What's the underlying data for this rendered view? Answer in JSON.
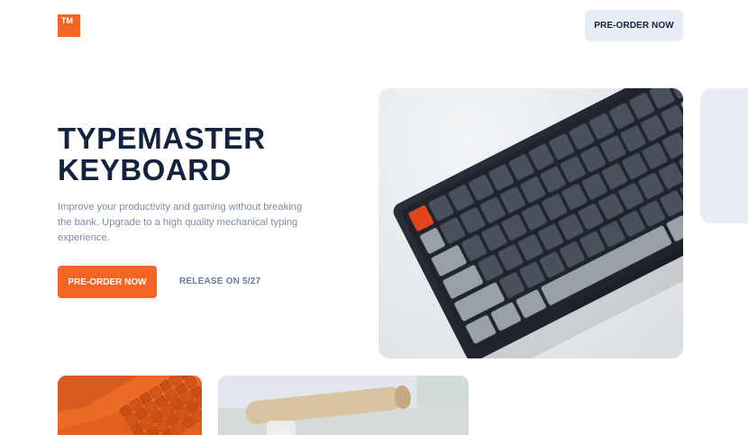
{
  "header": {
    "logo_text": "TM",
    "cta_label": "PRE-ORDER NOW"
  },
  "hero": {
    "title_line1": "TYPEMASTER",
    "title_line2": "KEYBOARD",
    "description": "Improve your productivity and gaming without breaking the bank. Upgrade to a high quality mechanical typing experience.",
    "cta_label": "PRE-ORDER NOW",
    "release_label": "RELEASE ON 5/27"
  },
  "colors": {
    "accent": "#f26522",
    "navy": "#13223f",
    "muted_text": "#7d8ca3",
    "light_panel": "#e8eef3"
  },
  "images": {
    "hero": "mechanical-keyboard-photo",
    "card_1": "orange-keyboard-photo",
    "card_2": "desk-workspace-photo"
  }
}
